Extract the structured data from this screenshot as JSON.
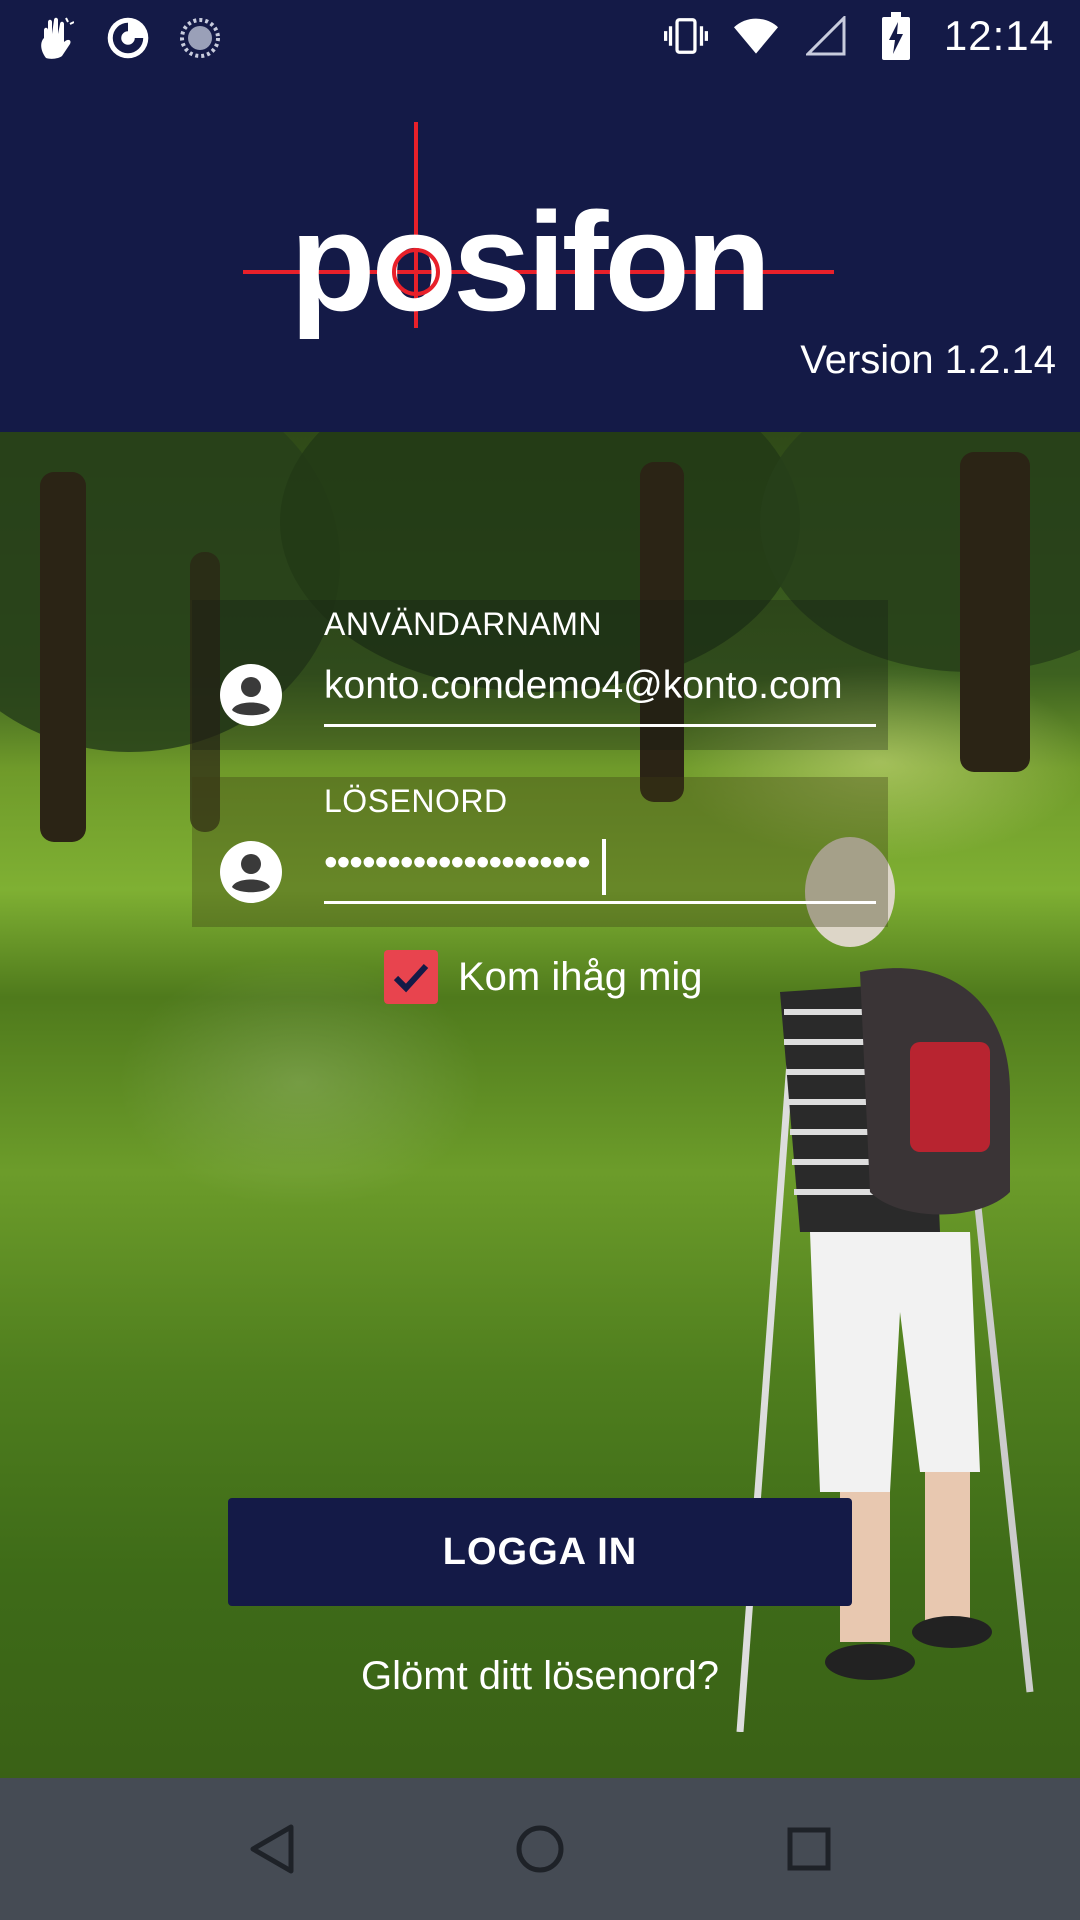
{
  "status_bar": {
    "time": "12:14",
    "icons": [
      "gesture-icon",
      "app-icon",
      "sync-icon",
      "vibrate-icon",
      "wifi-icon",
      "signal-icon",
      "battery-icon"
    ]
  },
  "header": {
    "logo_text": "posifon",
    "version": "Version 1.2.14",
    "background_color": "#141a47",
    "crosshair_color": "#e8202a"
  },
  "login": {
    "username": {
      "label": "ANVÄNDARNAMN",
      "value": "konto.comdemo4@konto.com"
    },
    "password": {
      "label": "LÖSENORD",
      "value": "•••••••••••••••••••••"
    },
    "remember_me": {
      "label": "Kom ihåg mig",
      "checked": true,
      "color": "#e8444e"
    },
    "login_button": "LOGGA IN",
    "forgot_link": "Glömt ditt lösenord?"
  },
  "nav_bar": {
    "buttons": [
      "back-icon",
      "home-icon",
      "recents-icon"
    ]
  }
}
